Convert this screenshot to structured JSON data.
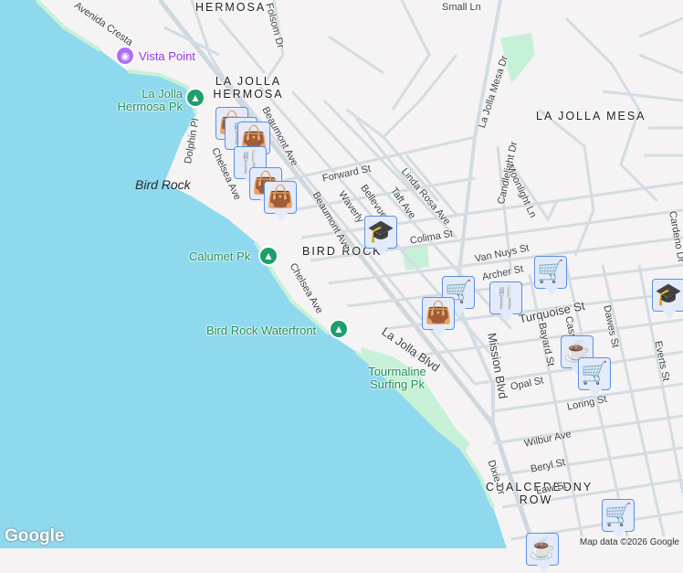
{
  "neighborhoods": {
    "hermosa": "HERMOSA",
    "la_jolla_hermosa": "LA JOLLA HERMOSA",
    "la_jolla_mesa": "LA JOLLA MESA",
    "bird_rock": "BIRD ROCK",
    "chalcedeony_row": "CHALCEDEONY ROW"
  },
  "parks": {
    "la_jolla_hermosa_pk": "La Jolla Hermosa Pk",
    "calumet_pk": "Calumet Pk",
    "bird_rock_waterfront": "Bird Rock Waterfront",
    "tourmaline": "Tourmaline Surfing Pk"
  },
  "poi": {
    "vista_point": "Vista Point"
  },
  "water": {
    "bird_rock": "Bird Rock"
  },
  "streets": {
    "avenida_cresta": "Avenida Cresta",
    "folsom": "Folsom Dr",
    "dolphin": "Dolphin Pl",
    "chelsea1": "Chelsea Ave",
    "chelsea2": "Chelsea Ave",
    "beaumont1": "Beaumont Ave",
    "beaumont2": "Beaumont Ave",
    "forward": "Forward St",
    "waverly": "Waverly",
    "bellevue": "Bellevue Ave",
    "taft": "Taft Ave",
    "linda_rosa": "Linda Rosa Ave",
    "colima": "Colima St",
    "van_nuys": "Van Nuys St",
    "archer": "Archer St",
    "la_jolla_mesa_dr": "La Jolla Mesa Dr",
    "candlelight": "Candlelight Dr",
    "moonlight": "Moonlight Ln",
    "cardeno": "Cardeno Dr",
    "turquoise": "Turquoise St",
    "la_jolla_blvd": "La Jolla Blvd",
    "mission_blvd": "Mission Blvd",
    "bayard": "Bayard St",
    "cass": "Cass St",
    "dawes": "Dawes St",
    "everts": "Everts St",
    "opal": "Opal St",
    "loring": "Loring St",
    "wilbur": "Wilbur Ave",
    "beryl": "Beryl St",
    "law": "Law St",
    "dixie": "Dixie Dr",
    "small_ln": "Small Ln"
  },
  "markers": [
    {
      "type": "shopping-bag",
      "glyph": "👜"
    },
    {
      "type": "restaurant",
      "glyph": "🍴"
    },
    {
      "type": "shopping-bag",
      "glyph": "👜"
    },
    {
      "type": "restaurant",
      "glyph": "🍴"
    },
    {
      "type": "shopping-bag",
      "glyph": "👜"
    },
    {
      "type": "shopping-bag",
      "glyph": "👜"
    },
    {
      "type": "school",
      "glyph": "🎓"
    },
    {
      "type": "grocery",
      "glyph": "🛒"
    },
    {
      "type": "grocery",
      "glyph": "🛒"
    },
    {
      "type": "shopping-bag",
      "glyph": "👜"
    },
    {
      "type": "restaurant",
      "glyph": "🍴"
    },
    {
      "type": "school",
      "glyph": "🎓"
    },
    {
      "type": "cafe",
      "glyph": "☕"
    },
    {
      "type": "grocery",
      "glyph": "🛒"
    },
    {
      "type": "grocery",
      "glyph": "🛒"
    },
    {
      "type": "cafe",
      "glyph": "☕"
    }
  ],
  "footer": {
    "logo": "Google",
    "attribution": "Map data ©2026 Google"
  },
  "colors": {
    "water": "#8fd9ee",
    "land": "#f5f3f3",
    "park": "#c6f1d6",
    "road": "#d3dce3",
    "pin": "#0b3d63"
  }
}
